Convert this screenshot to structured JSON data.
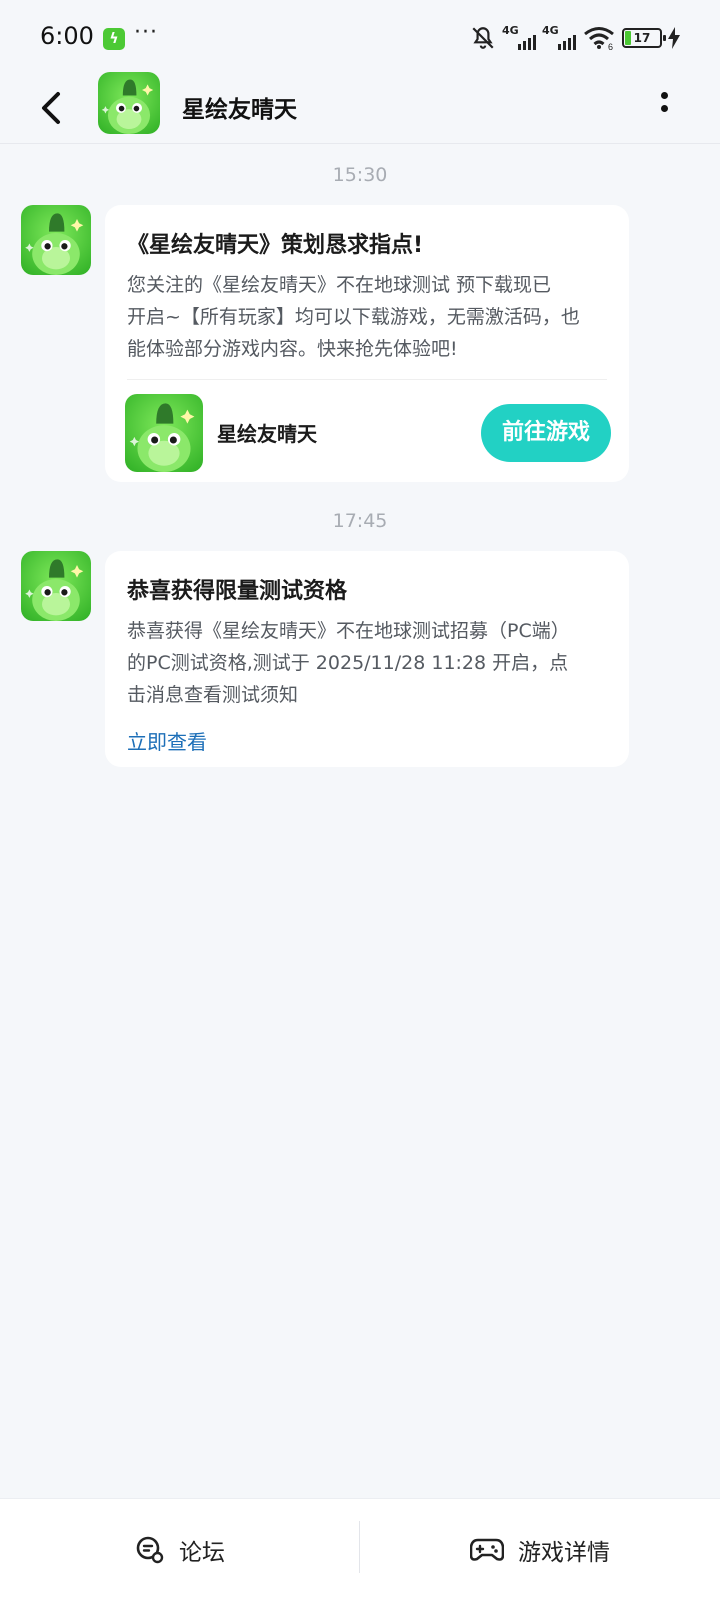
{
  "status_bar": {
    "time": "6:00",
    "app_indicator": "ϟ",
    "more": "···",
    "network_1": "4G",
    "network_2": "4G",
    "wifi_badge": "6",
    "battery_level": "17",
    "battery_fill_percent": 17,
    "icons": [
      "notifications-off-icon",
      "signal-icon",
      "signal-icon",
      "wifi-icon",
      "battery-icon",
      "charging-icon"
    ]
  },
  "header": {
    "title": "星绘友晴天",
    "icons": [
      "back-arrow-icon",
      "more-vertical-icon"
    ]
  },
  "messages": [
    {
      "time": "15:30",
      "title": "《星绘友晴天》策划恳求指点!",
      "body_lines": [
        "您关注的《星绘友晴天》不在地球测试 预下载现已",
        "开启~【所有玩家】均可以下载游戏，无需激活码，也",
        "能体验部分游戏内容。快来抢先体验吧!"
      ],
      "game_name": "星绘友晴天",
      "action_label": "前往游戏"
    },
    {
      "time": "17:45",
      "title": "恭喜获得限量测试资格",
      "body_lines": [
        "恭喜获得《星绘友晴天》不在地球测试招募（PC端）",
        "的PC测试资格,测试于 2025/11/28 11:28 开启，点",
        "击消息查看测试须知"
      ],
      "link_label": "立即查看"
    }
  ],
  "bottom_bar": {
    "forum_label": "论坛",
    "game_details_label": "游戏详情",
    "icons": [
      "forum-chat-icon",
      "gamepad-icon"
    ]
  },
  "colors": {
    "background": "#f5f7fa",
    "accent": "#22d1c4",
    "link": "#1d6fb8",
    "brand_green": "#4cc934"
  }
}
